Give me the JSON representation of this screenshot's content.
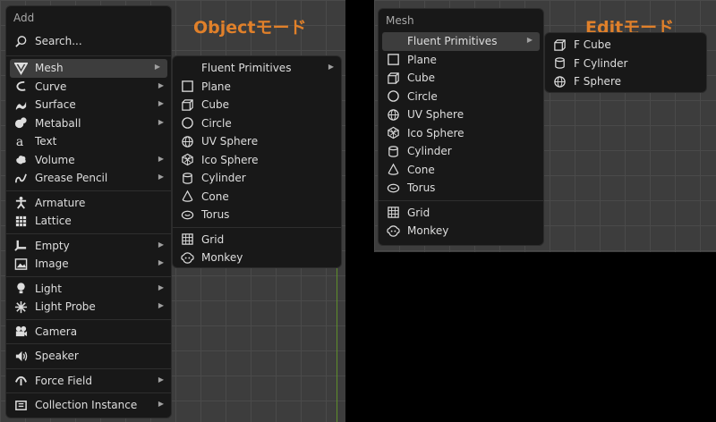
{
  "headings": {
    "object_mode": "Objectモード",
    "edit_mode": "Editモード"
  },
  "add_menu": {
    "title": "Add",
    "search_label": "Search...",
    "items": [
      {
        "label": "Mesh",
        "icon": "mesh-icon",
        "submenu": true
      },
      {
        "label": "Curve",
        "icon": "curve-icon",
        "submenu": true
      },
      {
        "label": "Surface",
        "icon": "surface-icon",
        "submenu": true
      },
      {
        "label": "Metaball",
        "icon": "metaball-icon",
        "submenu": true
      },
      {
        "label": "Text",
        "icon": "text-icon",
        "submenu": false
      },
      {
        "label": "Volume",
        "icon": "volume-icon",
        "submenu": true
      },
      {
        "label": "Grease Pencil",
        "icon": "grease-pencil-icon",
        "submenu": true
      },
      {
        "label": "Armature",
        "icon": "armature-icon",
        "submenu": false
      },
      {
        "label": "Lattice",
        "icon": "lattice-icon",
        "submenu": false
      },
      {
        "label": "Empty",
        "icon": "empty-icon",
        "submenu": true
      },
      {
        "label": "Image",
        "icon": "image-icon",
        "submenu": true
      },
      {
        "label": "Light",
        "icon": "light-icon",
        "submenu": true
      },
      {
        "label": "Light Probe",
        "icon": "light-probe-icon",
        "submenu": true
      },
      {
        "label": "Camera",
        "icon": "camera-icon",
        "submenu": false
      },
      {
        "label": "Speaker",
        "icon": "speaker-icon",
        "submenu": false
      },
      {
        "label": "Force Field",
        "icon": "force-field-icon",
        "submenu": true
      },
      {
        "label": "Collection Instance",
        "icon": "collection-icon",
        "submenu": true
      }
    ]
  },
  "mesh_submenu": {
    "fluent_label": "Fluent Primitives",
    "items": [
      {
        "label": "Plane",
        "icon": "plane-icon"
      },
      {
        "label": "Cube",
        "icon": "cube-icon"
      },
      {
        "label": "Circle",
        "icon": "circle-icon"
      },
      {
        "label": "UV Sphere",
        "icon": "uv-sphere-icon"
      },
      {
        "label": "Ico Sphere",
        "icon": "ico-sphere-icon"
      },
      {
        "label": "Cylinder",
        "icon": "cylinder-icon"
      },
      {
        "label": "Cone",
        "icon": "cone-icon"
      },
      {
        "label": "Torus",
        "icon": "torus-icon"
      },
      {
        "label": "Grid",
        "icon": "grid-icon"
      },
      {
        "label": "Monkey",
        "icon": "monkey-icon"
      }
    ]
  },
  "edit_mesh_menu": {
    "title": "Mesh",
    "fluent_label": "Fluent Primitives",
    "items": [
      {
        "label": "Plane",
        "icon": "plane-icon"
      },
      {
        "label": "Cube",
        "icon": "cube-icon"
      },
      {
        "label": "Circle",
        "icon": "circle-icon"
      },
      {
        "label": "UV Sphere",
        "icon": "uv-sphere-icon"
      },
      {
        "label": "Ico Sphere",
        "icon": "ico-sphere-icon"
      },
      {
        "label": "Cylinder",
        "icon": "cylinder-icon"
      },
      {
        "label": "Cone",
        "icon": "cone-icon"
      },
      {
        "label": "Torus",
        "icon": "torus-icon"
      },
      {
        "label": "Grid",
        "icon": "grid-icon"
      },
      {
        "label": "Monkey",
        "icon": "monkey-icon"
      }
    ]
  },
  "fluent_submenu": {
    "items": [
      {
        "label": "F Cube",
        "icon": "cube-icon"
      },
      {
        "label": "F Cylinder",
        "icon": "cylinder-icon"
      },
      {
        "label": "F Sphere",
        "icon": "uv-sphere-icon"
      }
    ]
  },
  "colors": {
    "heading": "#e0802a",
    "menu_bg": "#181818",
    "highlight": "#3d3d3d",
    "text": "#dedede"
  }
}
